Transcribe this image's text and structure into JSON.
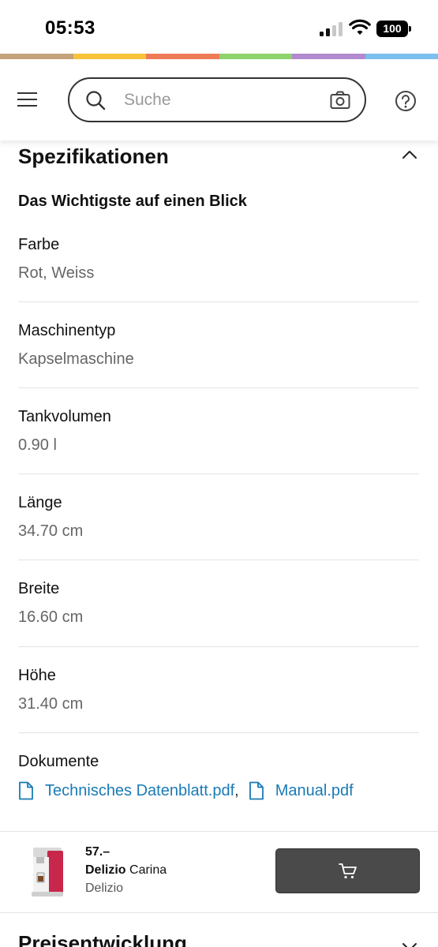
{
  "status": {
    "time": "05:53",
    "battery": "100"
  },
  "colors": {
    "strip": [
      "#c4a27a",
      "#f6c33a",
      "#ee7b57",
      "#8ed36b",
      "#b28ad0",
      "#7bbfef"
    ],
    "link": "#1a7ab5"
  },
  "header": {
    "search_placeholder": "Suche",
    "icons": [
      "menu-icon",
      "search-icon",
      "camera-icon",
      "help-icon"
    ]
  },
  "specs": {
    "title": "Spezifikationen",
    "subtitle": "Das Wichtigste auf einen Blick",
    "items": [
      {
        "label": "Farbe",
        "value": "Rot, Weiss"
      },
      {
        "label": "Maschinentyp",
        "value": "Kapselmaschine"
      },
      {
        "label": "Tankvolumen",
        "value": "0.90 l"
      },
      {
        "label": "Länge",
        "value": "34.70 cm"
      },
      {
        "label": "Breite",
        "value": "16.60 cm"
      },
      {
        "label": "Höhe",
        "value": "31.40 cm"
      }
    ],
    "documents": {
      "label": "Dokumente",
      "links": [
        "Technisches Datenblatt.pdf",
        "Manual.pdf"
      ],
      "separator": ","
    }
  },
  "product_bar": {
    "price": "57.–",
    "name_bold": "Delizio",
    "name_rest": " Carina",
    "brand": "Delizio"
  },
  "next_section": {
    "title": "Preisentwicklung"
  }
}
